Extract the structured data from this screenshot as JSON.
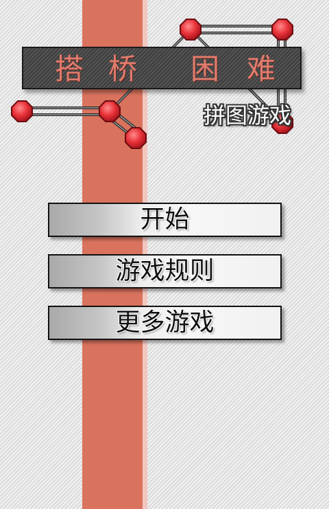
{
  "title": {
    "chars": [
      "搭",
      "桥",
      "困",
      "难"
    ]
  },
  "subtitle": "拼图游戏",
  "menu": {
    "start_label": "开始",
    "rules_label": "游戏规则",
    "more_games_label": "更多游戏"
  },
  "colors": {
    "stripe": "#d9735e",
    "node": "#e8333a",
    "title_text": "#e27c6d",
    "banner": "#4a4a4a"
  }
}
